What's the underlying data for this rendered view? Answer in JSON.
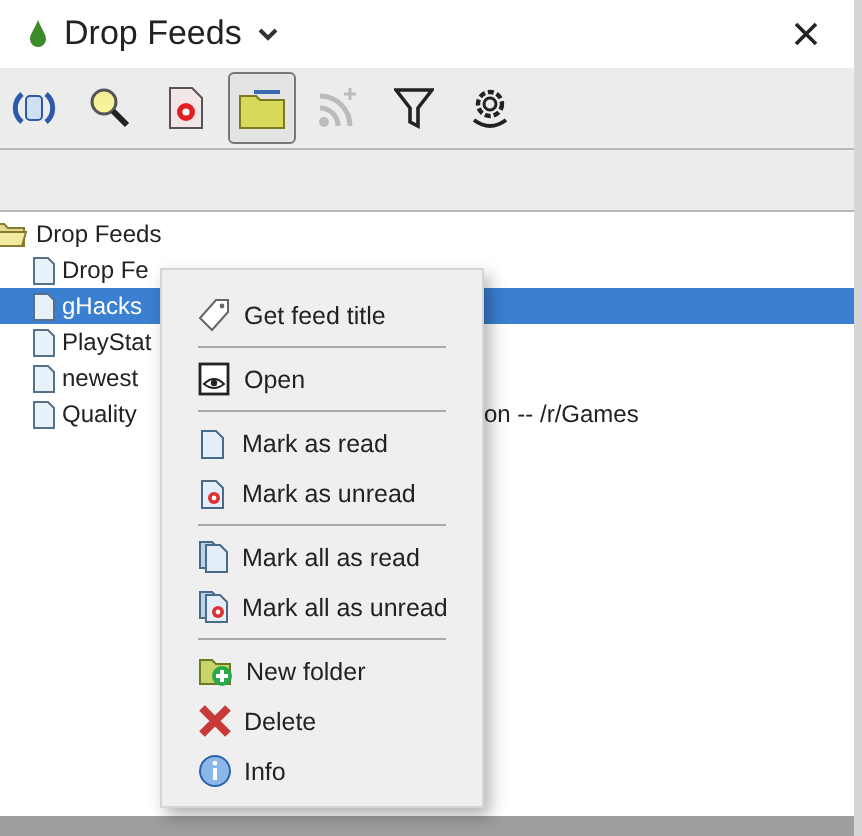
{
  "window": {
    "title": "Drop Feeds"
  },
  "toolbar": [
    {
      "selected": false,
      "disabled": false
    },
    {
      "selected": false,
      "disabled": false
    },
    {
      "selected": false,
      "disabled": false
    },
    {
      "selected": true,
      "disabled": false
    },
    {
      "selected": false,
      "disabled": true
    },
    {
      "selected": false,
      "disabled": false
    },
    {
      "selected": false,
      "disabled": false
    }
  ],
  "tree": {
    "label": "Drop Feeds",
    "expanded": true,
    "children": [
      {
        "label": "Drop Fe",
        "selected": false
      },
      {
        "label": "gHacks",
        "selected": true
      },
      {
        "label": "PlayStat",
        "selected": false
      },
      {
        "label": "newest",
        "selected": false
      },
      {
        "label": "Quality",
        "continuation": "on -- /r/Games",
        "selected": false
      }
    ]
  },
  "context_menu": [
    {
      "kind": "item",
      "label": "Get feed title"
    },
    {
      "kind": "separator"
    },
    {
      "kind": "item",
      "label": "Open"
    },
    {
      "kind": "separator"
    },
    {
      "kind": "item",
      "label": "Mark as read"
    },
    {
      "kind": "item",
      "label": "Mark as unread"
    },
    {
      "kind": "separator"
    },
    {
      "kind": "item",
      "label": "Mark all as read"
    },
    {
      "kind": "item",
      "label": "Mark all as unread"
    },
    {
      "kind": "separator"
    },
    {
      "kind": "item",
      "label": "New folder"
    },
    {
      "kind": "item",
      "label": "Delete"
    },
    {
      "kind": "item",
      "label": "Info"
    }
  ]
}
